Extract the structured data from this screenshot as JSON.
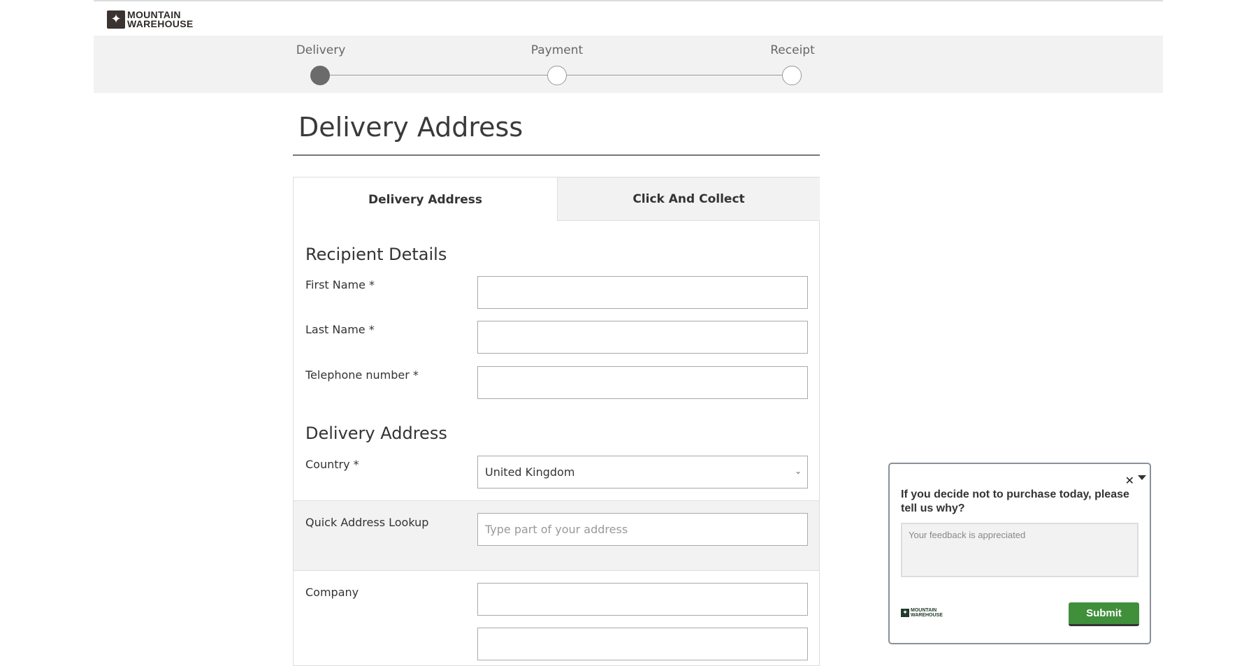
{
  "brand": {
    "line1": "MOUNTAIN",
    "line2": "WAREHOUSE"
  },
  "steps": [
    {
      "label": "Delivery",
      "active": true
    },
    {
      "label": "Payment",
      "active": false
    },
    {
      "label": "Receipt",
      "active": false
    }
  ],
  "page_title": "Delivery Address",
  "tabs": [
    "Delivery Address",
    "Click And Collect"
  ],
  "recipient": {
    "heading": "Recipient Details",
    "first_name": "First Name *",
    "last_name": "Last Name *",
    "telephone": "Telephone number *"
  },
  "address": {
    "heading": "Delivery Address",
    "country_label": "Country *",
    "country_value": "United Kingdom",
    "lookup_label": "Quick Address Lookup",
    "lookup_placeholder": "Type part of your address",
    "company_label": "Company"
  },
  "feedback": {
    "question": "If you decide not to purchase today, please tell us why?",
    "placeholder": "Your feedback is appreciated",
    "submit": "Submit",
    "brand_line1": "MOUNTAIN",
    "brand_line2": "WAREHOUSE"
  },
  "colors": {
    "submit": "#3f8f3b",
    "band": "#f2f2f2"
  }
}
